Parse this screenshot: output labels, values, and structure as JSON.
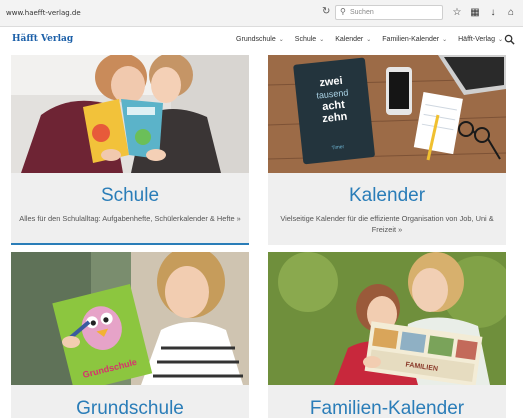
{
  "browser": {
    "url": "www.haefft-verlag.de",
    "search_placeholder": "Suchen"
  },
  "header": {
    "logo": "Häfft Verlag",
    "nav": [
      {
        "label": "Grundschule"
      },
      {
        "label": "Schule"
      },
      {
        "label": "Kalender"
      },
      {
        "label": "Familien-Kalender"
      },
      {
        "label": "Häfft-Verlag"
      }
    ]
  },
  "cards": [
    {
      "title": "Schule",
      "description": "Alles für den Schulalltag: Aufgabenhefte, Schülerkalender & Hefte »"
    },
    {
      "title": "Kalender",
      "description": "Vielseitige Kalender für die effiziente Organisation von Job, Uni & Freizeit »",
      "image_text": "zwei tausend acht zehn",
      "image_text2": "Timer"
    },
    {
      "title": "Grundschule",
      "image_text": "Grundschule"
    },
    {
      "title": "Familien-Kalender",
      "image_text": "FAMILIEN"
    }
  ],
  "colors": {
    "accent": "#2a7db8",
    "logo": "#1b5fa8",
    "card_bg": "#efefef"
  }
}
